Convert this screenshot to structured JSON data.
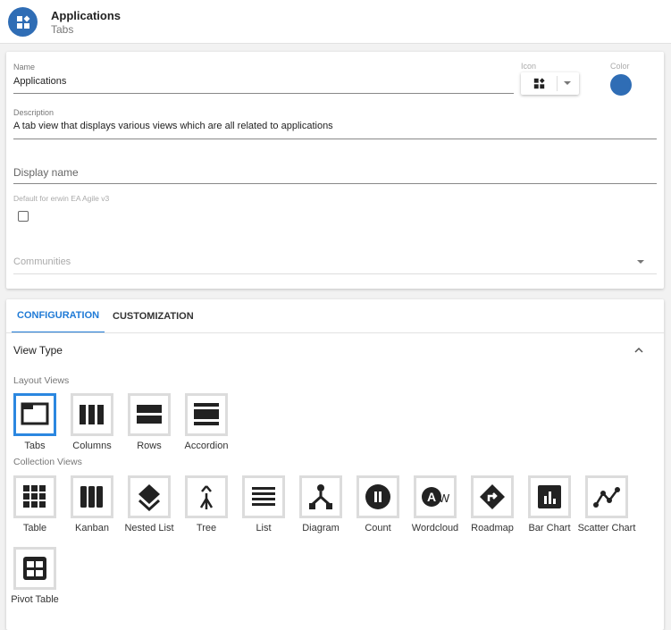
{
  "header": {
    "title": "Applications",
    "subtitle": "Tabs",
    "icon": "apps-icon"
  },
  "form": {
    "name_label": "Name",
    "name_value": "Applications",
    "icon_label": "Icon",
    "color_label": "Color",
    "color_value": "#2f6db5",
    "description_label": "Description",
    "description_value": "A tab view that displays various views which are all related to applications",
    "display_name_placeholder": "Display name",
    "default_label": "Default for erwin EA Agile v3",
    "default_checked": false,
    "communities_placeholder": "Communities"
  },
  "tabs": [
    {
      "label": "CONFIGURATION",
      "active": true
    },
    {
      "label": "CUSTOMIZATION",
      "active": false
    }
  ],
  "view_type": {
    "title": "View Type",
    "layout_label": "Layout Views",
    "layout_views": [
      {
        "label": "Tabs",
        "icon": "tabs",
        "selected": true
      },
      {
        "label": "Columns",
        "icon": "columns"
      },
      {
        "label": "Rows",
        "icon": "rows"
      },
      {
        "label": "Accordion",
        "icon": "accordion"
      }
    ],
    "collection_label": "Collection Views",
    "collection_views": [
      {
        "label": "Table",
        "icon": "table"
      },
      {
        "label": "Kanban",
        "icon": "kanban"
      },
      {
        "label": "Nested List",
        "icon": "nested"
      },
      {
        "label": "Tree",
        "icon": "tree"
      },
      {
        "label": "List",
        "icon": "list"
      },
      {
        "label": "Diagram",
        "icon": "diagram"
      },
      {
        "label": "Count",
        "icon": "count"
      },
      {
        "label": "Wordcloud",
        "icon": "wordcloud"
      },
      {
        "label": "Roadmap",
        "icon": "roadmap"
      },
      {
        "label": "Bar Chart",
        "icon": "barchart"
      },
      {
        "label": "Scatter Chart",
        "icon": "scatter"
      },
      {
        "label": "Pivot Table",
        "icon": "pivot"
      }
    ]
  }
}
